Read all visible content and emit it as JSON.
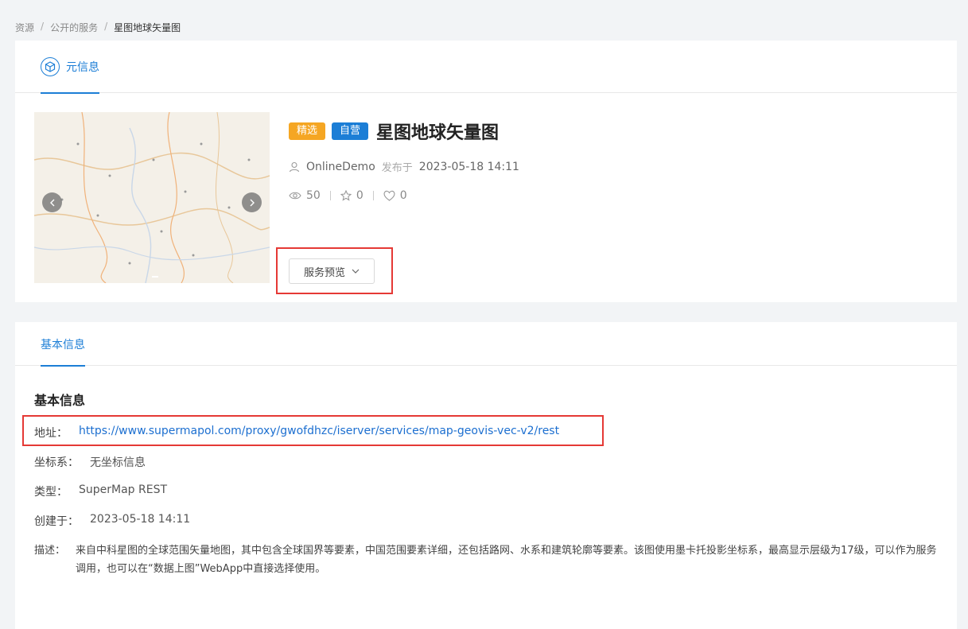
{
  "breadcrumb": {
    "root": "资源",
    "section": "公开的服务",
    "current": "星图地球矢量图",
    "separator": "/"
  },
  "meta_tab": {
    "label": "元信息",
    "icon": "cube-icon"
  },
  "resource": {
    "badge_featured": "精选",
    "badge_self": "自营",
    "title": "星图地球矢量图",
    "author": "OnlineDemo",
    "published_label": "发布于",
    "published_at": "2023-05-18 14:11",
    "views": "50",
    "stars": "0",
    "likes": "0",
    "preview_button": "服务预览"
  },
  "basic_tab": {
    "label": "基本信息"
  },
  "basic": {
    "section_title": "基本信息",
    "address_label": "地址：",
    "address": "https://www.supermapol.com/proxy/gwofdhzc/iserver/services/map-geovis-vec-v2/rest",
    "crs_label": "坐标系：",
    "crs": "无坐标信息",
    "type_label": "类型：",
    "type": "SuperMap REST",
    "created_label": "创建于：",
    "created": "2023-05-18 14:11",
    "desc_label": "描述：",
    "desc": "来自中科星图的全球范围矢量地图，其中包含全球国界等要素，中国范围要素详细，还包括路网、水系和建筑轮廓等要素。该图使用墨卡托投影坐标系，最高显示层级为17级，可以作为服务调用，也可以在“数据上图”WebApp中直接选择使用。"
  },
  "colors": {
    "accent": "#1c7ed6",
    "featured": "#f5a623",
    "highlight": "#e53935"
  }
}
